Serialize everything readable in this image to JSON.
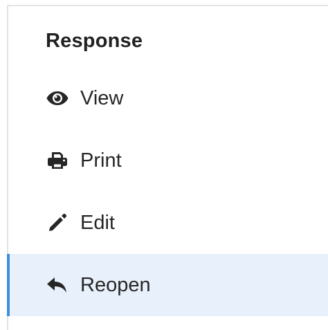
{
  "panel": {
    "heading": "Response"
  },
  "menu": {
    "items": [
      {
        "label": "View",
        "icon": "eye-icon"
      },
      {
        "label": "Print",
        "icon": "printer-icon"
      },
      {
        "label": "Edit",
        "icon": "pencil-icon"
      },
      {
        "label": "Reopen",
        "icon": "reply-icon",
        "active": true
      }
    ]
  },
  "colors": {
    "accent": "#3d8ee0",
    "active_background": "#e8f1fb",
    "text": "#262626",
    "border": "#e3e3e3"
  }
}
